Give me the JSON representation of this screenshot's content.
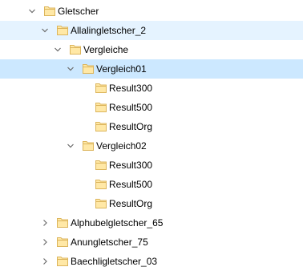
{
  "tree": {
    "nodes": [
      {
        "label": "Gletscher",
        "depth": 0,
        "expander": "expanded",
        "state": "normal"
      },
      {
        "label": "Allalingletscher_2",
        "depth": 1,
        "expander": "expanded",
        "state": "hover"
      },
      {
        "label": "Vergleiche",
        "depth": 2,
        "expander": "expanded",
        "state": "normal"
      },
      {
        "label": "Vergleich01",
        "depth": 3,
        "expander": "expanded",
        "state": "selected"
      },
      {
        "label": "Result300",
        "depth": 4,
        "expander": "none",
        "state": "normal"
      },
      {
        "label": "Result500",
        "depth": 4,
        "expander": "none",
        "state": "normal"
      },
      {
        "label": "ResultOrg",
        "depth": 4,
        "expander": "none",
        "state": "normal"
      },
      {
        "label": "Vergleich02",
        "depth": 3,
        "expander": "expanded",
        "state": "normal"
      },
      {
        "label": "Result300",
        "depth": 4,
        "expander": "none",
        "state": "normal"
      },
      {
        "label": "Result500",
        "depth": 4,
        "expander": "none",
        "state": "normal"
      },
      {
        "label": "ResultOrg",
        "depth": 4,
        "expander": "none",
        "state": "normal"
      },
      {
        "label": "Alphubelgletscher_65",
        "depth": 1,
        "expander": "collapsed",
        "state": "normal"
      },
      {
        "label": "Anungletscher_75",
        "depth": 1,
        "expander": "collapsed",
        "state": "normal"
      },
      {
        "label": "Baechligletscher_03",
        "depth": 1,
        "expander": "collapsed",
        "state": "normal"
      }
    ]
  },
  "colors": {
    "hover_bg": "#e5f3ff",
    "selected_bg": "#cce8ff",
    "folder_fill": "#ffe8a6",
    "folder_stroke": "#dcb55c",
    "chevron": "#6b6b6b"
  },
  "icons": {
    "expanded": "chevron-down-icon",
    "collapsed": "chevron-right-icon",
    "folder": "folder-icon"
  }
}
